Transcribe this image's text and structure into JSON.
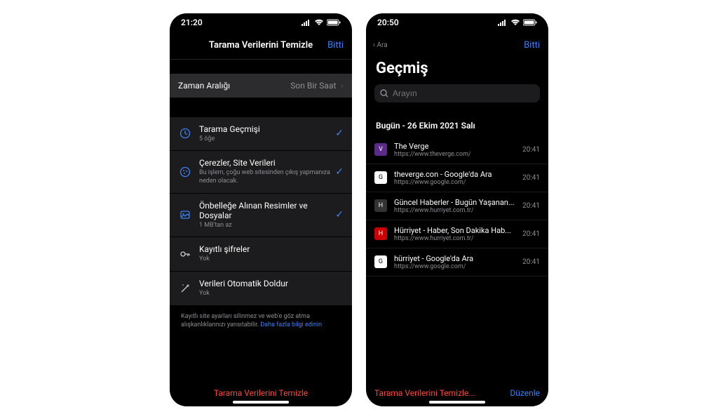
{
  "left": {
    "status_time": "21:20",
    "header_title": "Tarama Verilerini Temizle",
    "done_label": "Bitti",
    "time_range": {
      "label": "Zaman Aralığı",
      "value": "Son Bir Saat"
    },
    "items": [
      {
        "title": "Tarama Geçmişi",
        "sub": "5 öğe",
        "checked": true,
        "icon": "history"
      },
      {
        "title": "Çerezler, Site Verileri",
        "sub": "Bu işlem, çoğu web sitesinden çıkış yapmanıza neden olacak.",
        "checked": true,
        "icon": "cookie"
      },
      {
        "title": "Önbelleğe Alınan Resimler ve Dosyalar",
        "sub": "1 MB'tan az",
        "checked": true,
        "icon": "cache"
      },
      {
        "title": "Kayıtlı şifreler",
        "sub": "Yok",
        "checked": false,
        "icon": "key"
      },
      {
        "title": "Verileri Otomatik Doldur",
        "sub": "Yok",
        "checked": false,
        "icon": "wand"
      }
    ],
    "footnote_text": "Kayıtlı site ayarları silinmez ve web'e göz atma alışkanlıklarınızı yansıtabilir.",
    "footnote_link": "Daha fazla bilgi edinin",
    "bottom_action": "Tarama Verilerini Temizle"
  },
  "right": {
    "status_time": "20:50",
    "back_label": "‹ Ara",
    "done_label": "Bitti",
    "page_title": "Geçmiş",
    "search_placeholder": "Arayın",
    "date_header": "Bugün - 26 Ekim 2021 Salı",
    "entries": [
      {
        "title": "The Verge",
        "url": "https://www.theverge.com/",
        "time": "20:41",
        "fav": "V",
        "favbg": "#5b2b8a"
      },
      {
        "title": "theverge.con - Google'da Ara",
        "url": "https://www.google.com/",
        "time": "20:41",
        "fav": "G",
        "favbg": "#fff"
      },
      {
        "title": "Güncel Haberler - Bugün Yaşanan...",
        "url": "https://www.hurriyet.com.tr/",
        "time": "20:41",
        "fav": "H",
        "favbg": "#333"
      },
      {
        "title": "Hürriyet - Haber, Son Dakika Hab...",
        "url": "https://www.hurriyet.com.tr/",
        "time": "20:41",
        "fav": "H",
        "favbg": "#c00"
      },
      {
        "title": "hürriyet - Google'da Ara",
        "url": "https://www.google.com/",
        "time": "20:41",
        "fav": "G",
        "favbg": "#fff"
      }
    ],
    "bottom_clear": "Tarama Verilerini Temizle...",
    "bottom_edit": "Düzenle"
  }
}
